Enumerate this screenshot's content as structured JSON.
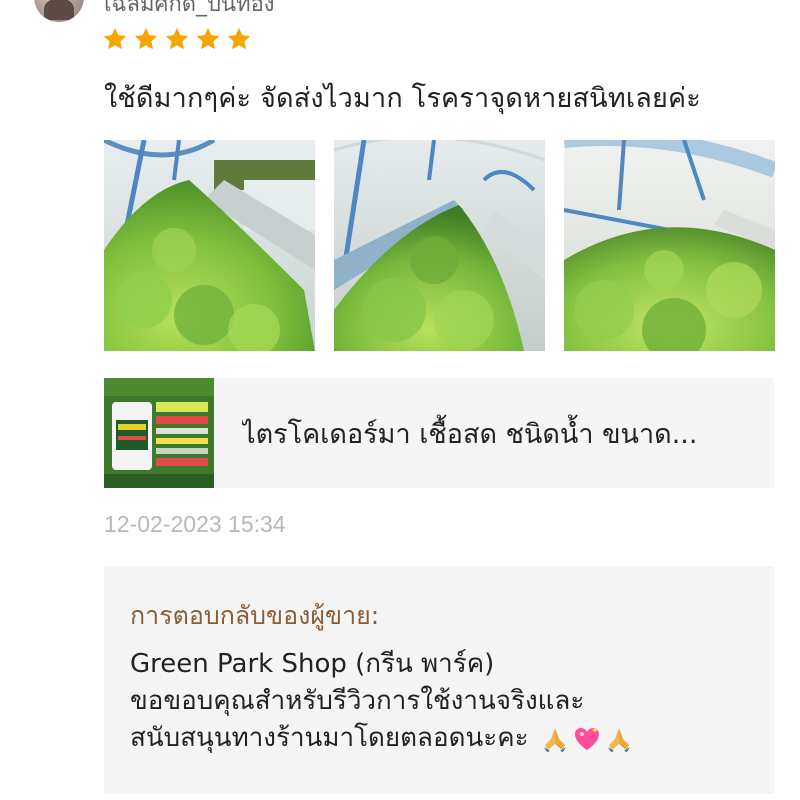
{
  "reviewer": {
    "username": "เฉลิมศักดิ์_ปิ่นทอง",
    "rating": 5
  },
  "review": {
    "text": "ใช้ดีมากๆค่ะ จัดส่งไวมาก โรคราจุดหายสนิทเลยค่ะ",
    "photos": [
      "lettuce-greenhouse-photo-1",
      "lettuce-greenhouse-photo-2",
      "lettuce-greenhouse-photo-3"
    ]
  },
  "product": {
    "name": "ไตรโคเดอร์มา เชื้อสด ชนิดน้ำ ขนาด..."
  },
  "timestamp": "12-02-2023 15:34",
  "seller_reply": {
    "title": "การตอบกลับของผู้ขาย:",
    "lines": [
      "Green Park Shop (กรีน พาร์ค)",
      "ขอขอบคุณสำหรับรีวิวการใช้งานจริงและ",
      "สนับสนุนทางร้านมาโดยตลอดนะคะ"
    ],
    "emojis": [
      "praying-hands-icon",
      "sparkling-heart-icon",
      "praying-hands-icon"
    ]
  },
  "colors": {
    "star": "#f6a600",
    "reply_title": "#8b5e34",
    "timestamp": "#b8b8b8",
    "card_bg": "#f5f5f5"
  }
}
